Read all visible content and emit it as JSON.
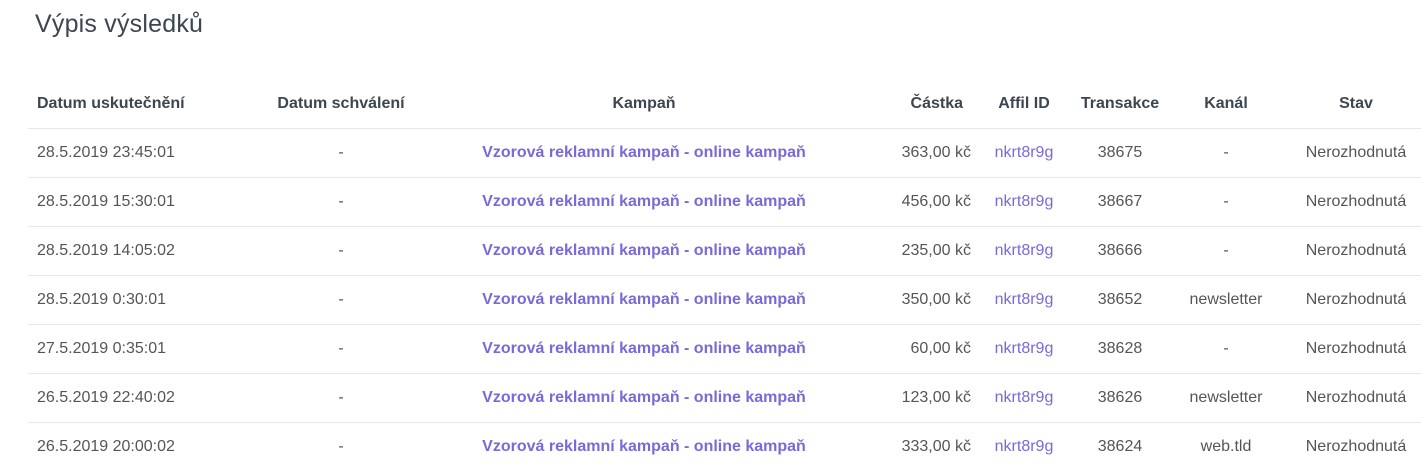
{
  "page": {
    "title": "Výpis výsledků"
  },
  "table": {
    "headers": {
      "datum": "Datum uskutečnění",
      "schvaleni": "Datum schválení",
      "kampan": "Kampaň",
      "castka": "Částka",
      "affil": "Affil ID",
      "transakce": "Transakce",
      "kanal": "Kanál",
      "stav": "Stav"
    },
    "rows": [
      {
        "datum": "28.5.2019 23:45:01",
        "schvaleni": "-",
        "kampan": "Vzorová reklamní kampaň - online kampaň",
        "castka": "363,00 kč",
        "affil": "nkrt8r9g",
        "transakce": "38675",
        "kanal": "-",
        "stav": "Nerozhodnutá"
      },
      {
        "datum": "28.5.2019 15:30:01",
        "schvaleni": "-",
        "kampan": "Vzorová reklamní kampaň - online kampaň",
        "castka": "456,00 kč",
        "affil": "nkrt8r9g",
        "transakce": "38667",
        "kanal": "-",
        "stav": "Nerozhodnutá"
      },
      {
        "datum": "28.5.2019 14:05:02",
        "schvaleni": "-",
        "kampan": "Vzorová reklamní kampaň - online kampaň",
        "castka": "235,00 kč",
        "affil": "nkrt8r9g",
        "transakce": "38666",
        "kanal": "-",
        "stav": "Nerozhodnutá"
      },
      {
        "datum": "28.5.2019 0:30:01",
        "schvaleni": "-",
        "kampan": "Vzorová reklamní kampaň - online kampaň",
        "castka": "350,00 kč",
        "affil": "nkrt8r9g",
        "transakce": "38652",
        "kanal": "newsletter",
        "stav": "Nerozhodnutá"
      },
      {
        "datum": "27.5.2019 0:35:01",
        "schvaleni": "-",
        "kampan": "Vzorová reklamní kampaň - online kampaň",
        "castka": "60,00 kč",
        "affil": "nkrt8r9g",
        "transakce": "38628",
        "kanal": "-",
        "stav": "Nerozhodnutá"
      },
      {
        "datum": "26.5.2019 22:40:02",
        "schvaleni": "-",
        "kampan": "Vzorová reklamní kampaň - online kampaň",
        "castka": "123,00 kč",
        "affil": "nkrt8r9g",
        "transakce": "38626",
        "kanal": "newsletter",
        "stav": "Nerozhodnutá"
      },
      {
        "datum": "26.5.2019 20:00:02",
        "schvaleni": "-",
        "kampan": "Vzorová reklamní kampaň - online kampaň",
        "castka": "333,00 kč",
        "affil": "nkrt8r9g",
        "transakce": "38624",
        "kanal": "web.tld",
        "stav": "Nerozhodnutá"
      }
    ]
  },
  "colors": {
    "link": "#7b68d9",
    "heading": "#3c4650",
    "text": "#555555",
    "divider": "#e6e8ea"
  }
}
